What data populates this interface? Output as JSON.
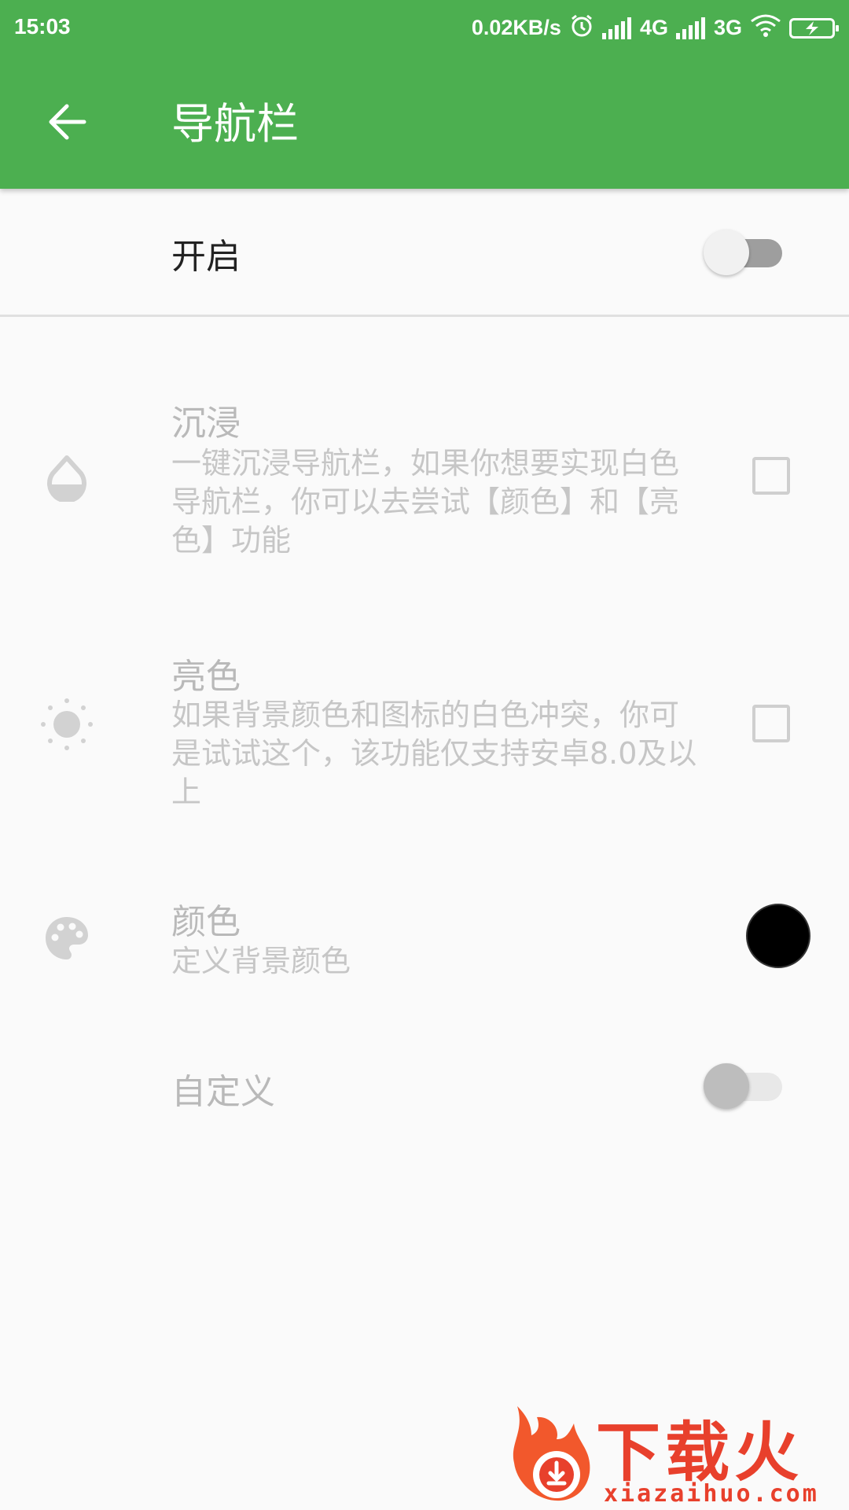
{
  "status_bar": {
    "time": "15:03",
    "speed": "0.02KB/s",
    "network1": "4G",
    "network2": "3G",
    "icons": [
      "alarm-icon",
      "signal-icon",
      "signal-icon",
      "wifi-icon",
      "battery-charging-icon"
    ]
  },
  "app_bar": {
    "title": "导航栏",
    "back_icon": "arrow-back-icon",
    "color": "#4caf50"
  },
  "settings": {
    "enable": {
      "label": "开启",
      "switch_on": false
    },
    "immersive": {
      "title": "沉浸",
      "description": "一键沉浸导航栏，如果你想要实现白色导航栏，你可以去尝试【颜色】和【亮色】功能",
      "icon": "drop-icon",
      "checked": false
    },
    "light": {
      "title": "亮色",
      "description": "如果背景颜色和图标的白色冲突，你可是试试这个，该功能仅支持安卓8.0及以上",
      "icon": "brightness-icon",
      "checked": false
    },
    "color": {
      "title": "颜色",
      "description": "定义背景颜色",
      "icon": "palette-icon",
      "value": "#000000"
    },
    "custom": {
      "label": "自定义",
      "switch_on": false
    }
  },
  "watermark": {
    "title": "下载火",
    "url": "xiazaihuo.com"
  }
}
